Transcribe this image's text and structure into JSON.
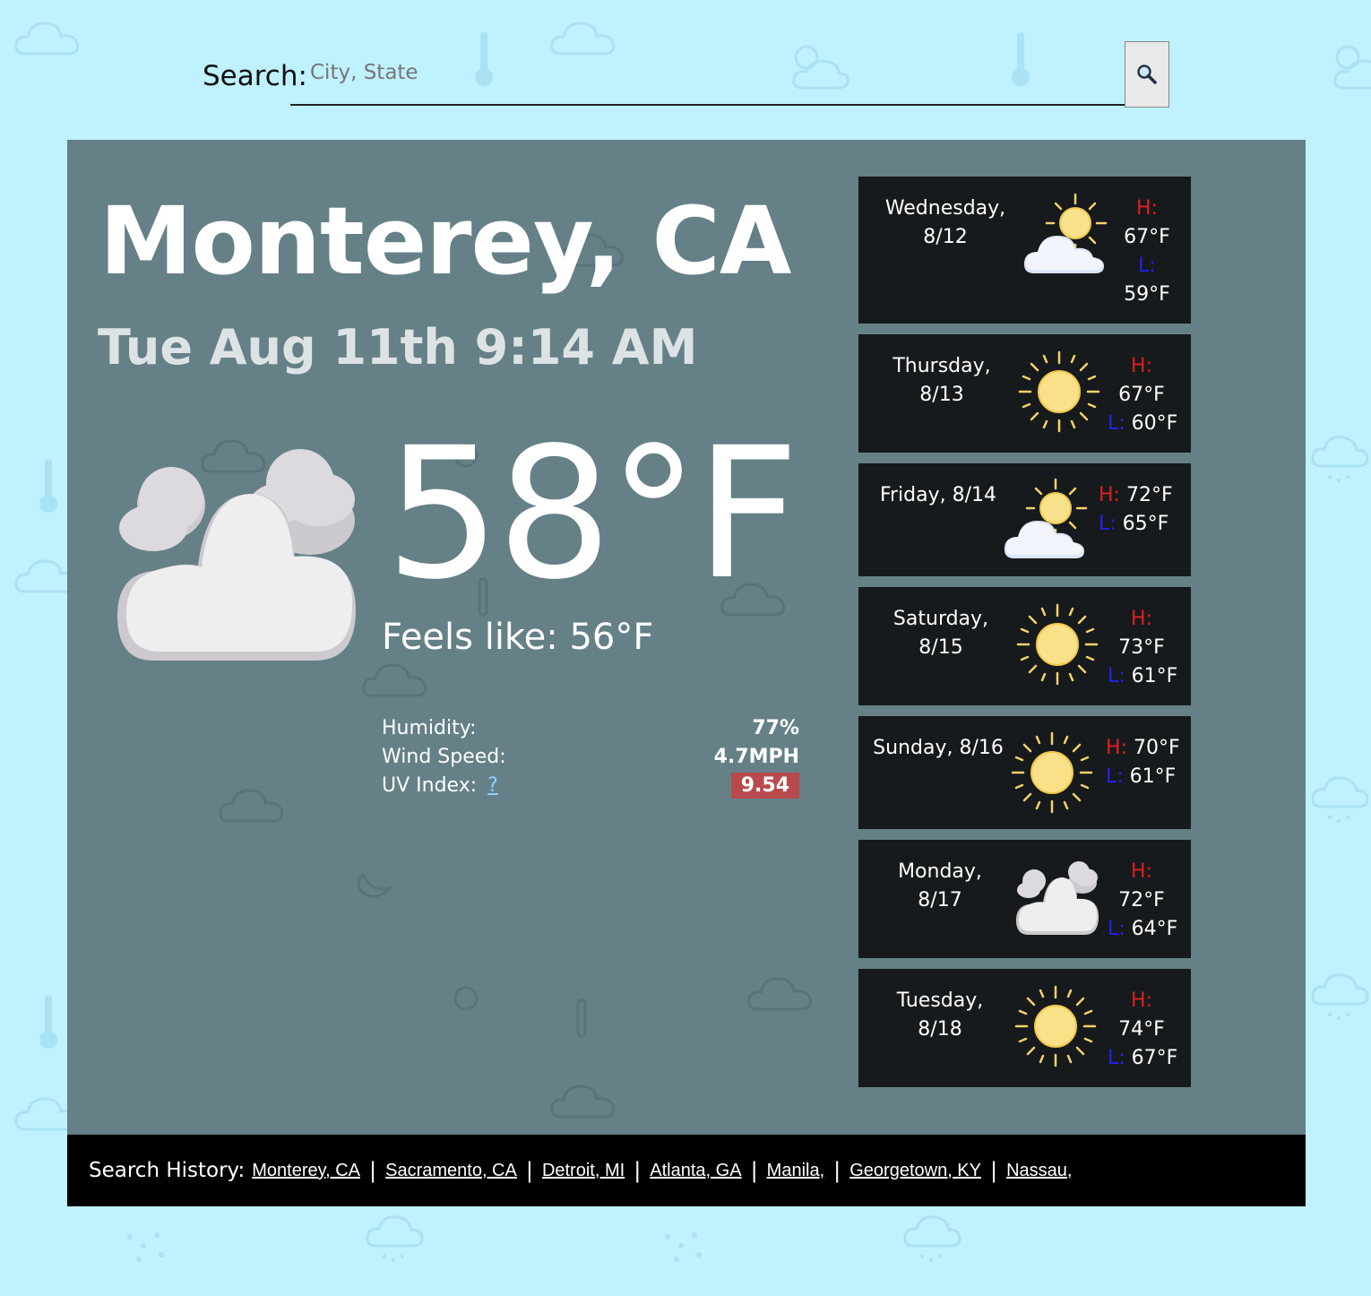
{
  "search": {
    "label": "Search:",
    "placeholder": "City, State",
    "value": ""
  },
  "current": {
    "city": "Monterey, CA",
    "datetime": "Tue Aug 11th 9:14 AM",
    "icon": "cloudy-icon",
    "temperature": "58°F",
    "feels_like": "Feels like: 56°F",
    "humidity_label": "Humidity:",
    "humidity": "77%",
    "wind_label": "Wind Speed:",
    "wind": "4.7MPH",
    "uv_label": "UV Index:",
    "uv_help": "?",
    "uv": "9.54",
    "uv_color": "#b84a4c"
  },
  "forecast": [
    {
      "day": "Wednesday,",
      "date": "8/12",
      "icon": "partly-cloudy-icon",
      "high_label": "H:",
      "high": "67°F",
      "low_label": "L:",
      "low": "59°F"
    },
    {
      "day": "Thursday,",
      "date": "8/13",
      "icon": "sun-icon",
      "high_label": "H:",
      "high": "67°F",
      "low_label": "L:",
      "low": "60°F"
    },
    {
      "day": "Friday, 8/14",
      "date": "",
      "icon": "partly-cloudy-icon",
      "high_label": "H:",
      "high": "72°F",
      "low_label": "L:",
      "low": "65°F"
    },
    {
      "day": "Saturday,",
      "date": "8/15",
      "icon": "sun-icon",
      "high_label": "H:",
      "high": "73°F",
      "low_label": "L:",
      "low": "61°F"
    },
    {
      "day": "Sunday, 8/16",
      "date": "",
      "icon": "sun-icon",
      "high_label": "H:",
      "high": "70°F",
      "low_label": "L:",
      "low": "61°F"
    },
    {
      "day": "Monday,",
      "date": "8/17",
      "icon": "cloudy-icon",
      "high_label": "H:",
      "high": "72°F",
      "low_label": "L:",
      "low": "64°F"
    },
    {
      "day": "Tuesday,",
      "date": "8/18",
      "icon": "sun-icon",
      "high_label": "H:",
      "high": "74°F",
      "low_label": "L:",
      "low": "67°F"
    }
  ],
  "history": {
    "label": "Search History:",
    "items": [
      "Monterey, CA",
      "Sacramento, CA",
      "Detroit, MI",
      "Atlanta, GA",
      "Manila,",
      "Georgetown, KY",
      "Nassau,"
    ],
    "separator": "|"
  },
  "colors": {
    "page_background": "#bff1ff",
    "panel_background": "#658087",
    "card_background": "#161a1c",
    "high_color": "#e01f1f",
    "low_color": "#2222ee"
  }
}
